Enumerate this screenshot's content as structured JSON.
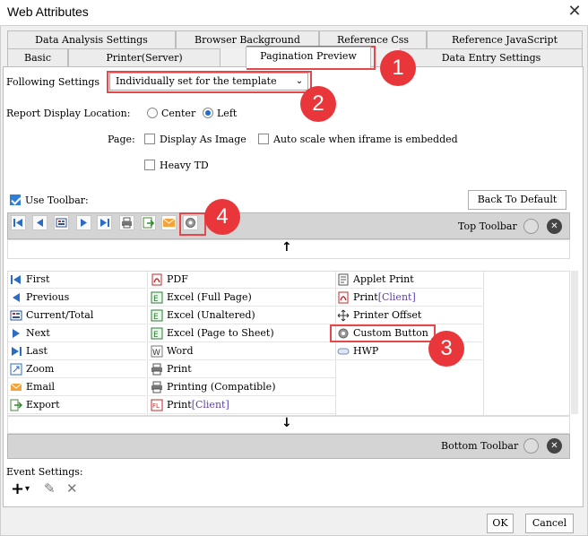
{
  "window": {
    "title": "Web Attributes",
    "close_glyph": "✕"
  },
  "tabs_row1": [
    {
      "label": "Data Analysis Settings"
    },
    {
      "label": "Browser Background"
    },
    {
      "label": "Reference Css"
    },
    {
      "label": "Reference JavaScript"
    }
  ],
  "tabs_row2": [
    {
      "label": "Basic"
    },
    {
      "label": "Printer(Server)"
    },
    {
      "label": "Pagination Preview"
    },
    {
      "label": "Data Entry Settings"
    }
  ],
  "settings": {
    "following_label": "Following Settings",
    "following_value": "Individually set for the template",
    "location_label": "Report Display Location:",
    "center_label": "Center",
    "left_label": "Left",
    "location_selected": "Left",
    "page_label": "Page:",
    "display_as_image_label": "Display As Image",
    "display_as_image_checked": false,
    "auto_scale_label": "Auto scale when iframe is embedded",
    "auto_scale_checked": false,
    "heavy_td_label": "Heavy TD",
    "heavy_td_checked": false,
    "use_toolbar_label": "Use Toolbar:",
    "use_toolbar_checked": true,
    "back_to_default": "Back To Default"
  },
  "top_toolbar": {
    "label": "Top Toolbar",
    "icons": [
      "first-page-icon",
      "previous-page-icon",
      "current-total-icon",
      "next-page-icon",
      "last-page-icon",
      "print-icon",
      "export-icon",
      "email-icon",
      "custom-button-gear-icon"
    ]
  },
  "bottom_toolbar": {
    "label": "Bottom Toolbar"
  },
  "arrows": {
    "up": "↑",
    "down": "↓"
  },
  "grid": {
    "col1": [
      {
        "label": "First",
        "icon": "first-icon"
      },
      {
        "label": "Previous",
        "icon": "previous-icon"
      },
      {
        "label": "Current/Total",
        "icon": "current-total-icon"
      },
      {
        "label": "Next",
        "icon": "next-icon"
      },
      {
        "label": "Last",
        "icon": "last-icon"
      },
      {
        "label": "Zoom",
        "icon": "zoom-icon"
      },
      {
        "label": "Email",
        "icon": "email-icon"
      },
      {
        "label": "Export",
        "icon": "export-icon"
      }
    ],
    "col2": [
      {
        "label": "PDF",
        "icon": "pdf-icon"
      },
      {
        "label": "Excel (Full Page)",
        "icon": "excel-icon"
      },
      {
        "label": "Excel (Unaltered)",
        "icon": "excel-icon"
      },
      {
        "label": "Excel (Page to Sheet)",
        "icon": "excel-icon"
      },
      {
        "label": "Word",
        "icon": "word-icon"
      },
      {
        "label": "Print",
        "icon": "print-icon"
      },
      {
        "label": "Printing (Compatible)",
        "icon": "print-icon"
      },
      {
        "label": "Print",
        "label_suffix": "[Client]",
        "icon": "print-client-icon"
      }
    ],
    "col3": [
      {
        "label": "Applet Print",
        "icon": "applet-print-icon"
      },
      {
        "label": "Print",
        "label_suffix": "[Client]",
        "icon": "pdf-print-client-icon"
      },
      {
        "label": "Printer Offset",
        "icon": "move-arrows-icon"
      },
      {
        "label": "Custom Button",
        "icon": "gear-icon"
      },
      {
        "label": "HWP",
        "icon": "hwp-icon"
      }
    ]
  },
  "event_settings": {
    "label": "Event Settings:",
    "add_glyph": "+",
    "add_dropdown_glyph": "▾",
    "edit_glyph": "✎",
    "delete_glyph": "✕"
  },
  "footer": {
    "ok": "OK",
    "cancel": "Cancel"
  },
  "badges": [
    "1",
    "2",
    "3",
    "4"
  ],
  "colors": {
    "accent_red": "#e8474a",
    "badge_red": "#e8363a",
    "blue": "#2f7fd8"
  }
}
